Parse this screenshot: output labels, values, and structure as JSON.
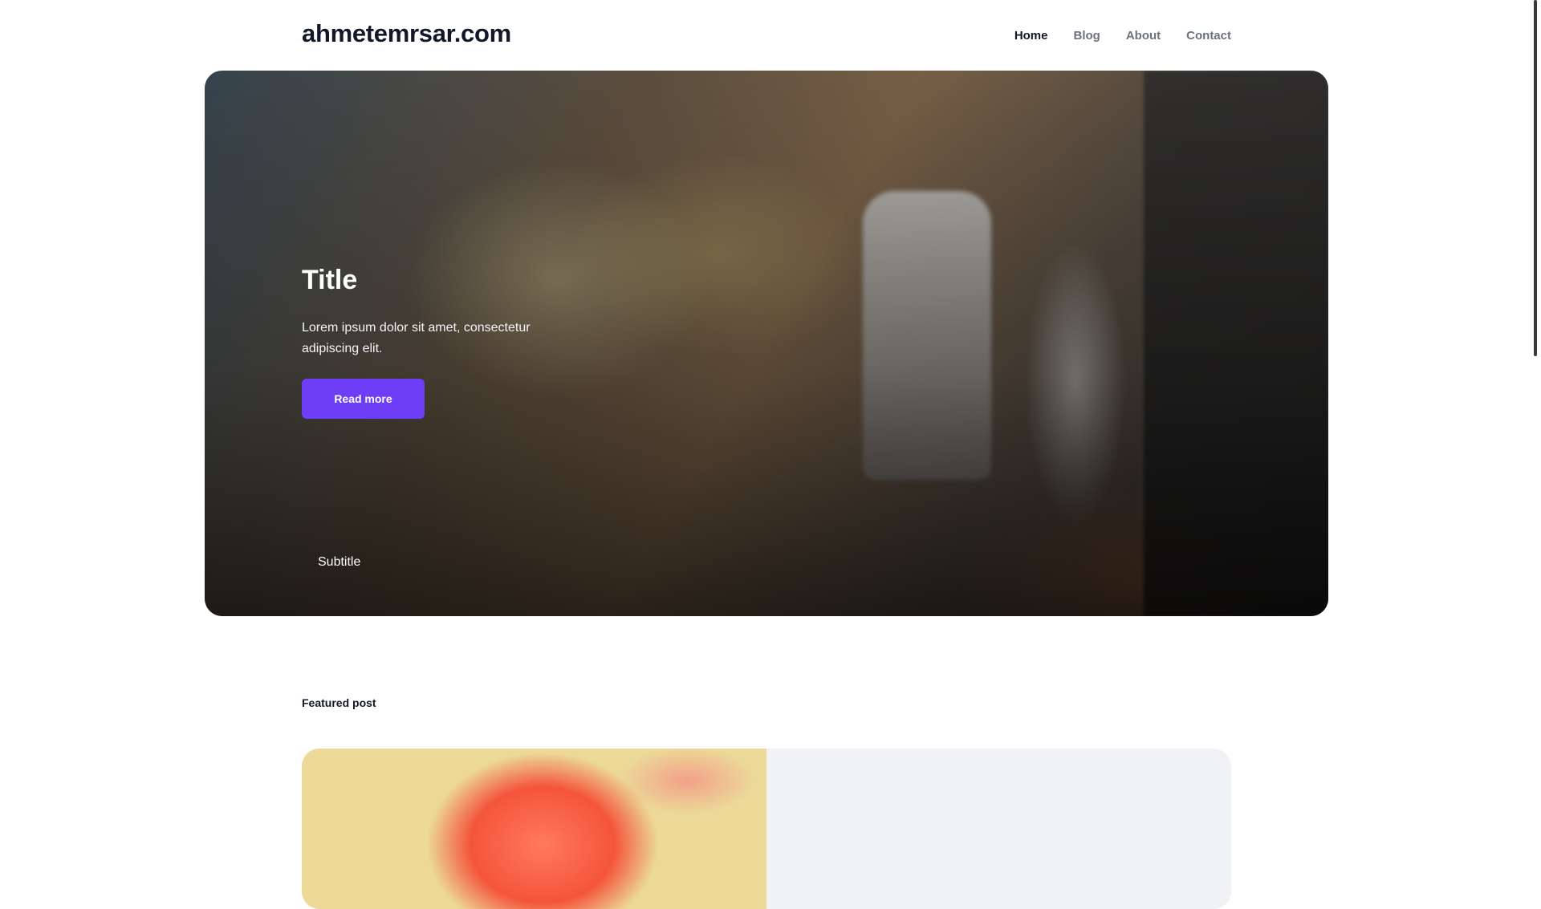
{
  "site": {
    "logo": "ahmetemrsar.com"
  },
  "nav": {
    "items": [
      {
        "label": "Home",
        "active": true
      },
      {
        "label": "Blog",
        "active": false
      },
      {
        "label": "About",
        "active": false
      },
      {
        "label": "Contact",
        "active": false
      }
    ]
  },
  "hero": {
    "title": "Title",
    "description": "Lorem ipsum dolor sit amet, consectetur adipiscing elit.",
    "button_label": "Read more",
    "subtitle": "Subtitle"
  },
  "featured": {
    "section_label": "Featured post"
  },
  "colors": {
    "accent": "#6d3ef5",
    "text_primary": "#111827",
    "text_muted": "#6b7280",
    "card_bg": "#f1f2f6"
  }
}
